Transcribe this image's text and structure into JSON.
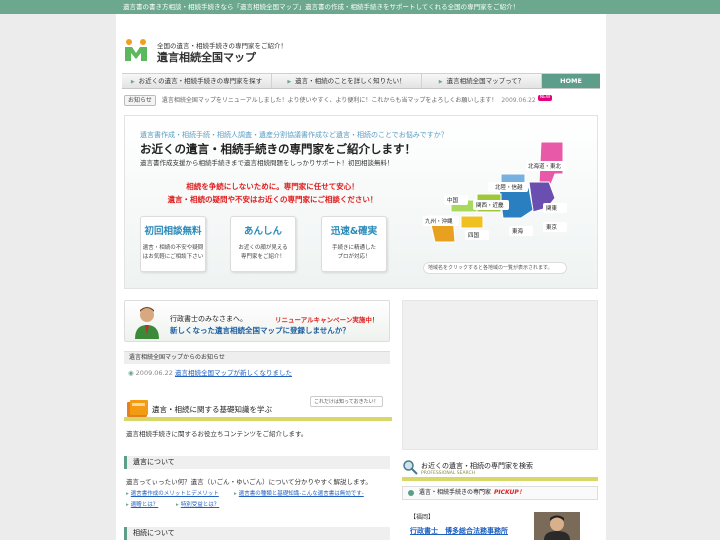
{
  "topbar": {
    "text": "遺言書の書き方相談・相続手続きなら「遺言相続全国マップ」遺言書の作成・相続手続きをサポートしてくれる全国の専門家をご紹介！"
  },
  "header": {
    "tagline": "全国の遺言・相続手続きの専門家をご紹介！",
    "site_title": "遺言相続全国マップ"
  },
  "nav": {
    "items": [
      {
        "label": "お近くの遺言・相続手続きの専門家を探す"
      },
      {
        "label": "遺言・相続のことを詳しく知りたい！"
      },
      {
        "label": "遺言相続全国マップって？"
      }
    ],
    "home_label": "HOME"
  },
  "notice": {
    "label": "お知らせ",
    "text": "遺言相続全国マップをリニューアルしました！より使いやすく、より便利に！これからも当マップをよろしくお願いします！",
    "date": "2009.06.22",
    "badge": "NEW"
  },
  "hero": {
    "subtitle": "遺言書作成・相続手続・相続人調査・遺産分割協議書作成など遺言・相続のことでお悩みですか？",
    "title": "お近くの遺言・相続手続きの専門家をご紹介します！",
    "description": "遺言書作成支援から相続手続きまで遺言相続問題をしっかりサポート！初回相談無料！",
    "message_line1": "相続を争続にしないために。専門家に任せて安心！",
    "message_line2": "遺言・相続の疑問や不安はお近くの専門家にご相談ください！",
    "features": [
      {
        "title": "初回相談無料",
        "line1": "遺言・相続の不安や疑問",
        "line2": "はお気軽にご相談下さい"
      },
      {
        "title": "あんしん",
        "line1": "お近くの顔が見える",
        "line2": "専門家をご紹介！"
      },
      {
        "title": "迅速&確実",
        "line1": "手続きに精通した",
        "line2": "プロが対応！"
      }
    ],
    "map": {
      "regions": [
        "北海道・東北",
        "北陸・信越",
        "中国",
        "関西・近畿",
        "関東",
        "九州・沖縄",
        "四国",
        "東海",
        "東京"
      ],
      "note": "地域名をクリックすると各地域の一覧が表示されます。"
    }
  },
  "admin_banner": {
    "greeting": "行政書士のみなさまへ。",
    "campaign": "リニューアルキャンペーン実施中！",
    "cta": "新しくなった遺言相続全国マップに登録しませんか？"
  },
  "news": {
    "header": "遺言相続全国マップからのお知らせ",
    "items": [
      {
        "date": "2009.06.22",
        "link": "遺言相続全国マップが新しくなりました"
      }
    ]
  },
  "basics": {
    "tag": "これだけは知っておきたい！",
    "title": "遺言・相続に関する基礎知識を学ぶ",
    "description": "遺言相続手続きに関するお役立ちコンテンツをご紹介します。"
  },
  "will_section": {
    "header": "遺言について",
    "description": "遺言ってぃったい何？遺言（いごん・ゆいごん）について分かりやすく解説します。",
    "links": [
      "遺言書作成のメリットとデメリット",
      "遺言書の種類と基礎知識-こんな遺言書は無効です-",
      "遺贈とは？",
      "特別受益とは？"
    ]
  },
  "inheritance_section": {
    "header": "相続について"
  },
  "search": {
    "title": "お近くの遺言・相続の専門家を検索",
    "subtitle": "PROFESSIONAL SEARCH",
    "pickup_label": "遺言・相続手続きの専門家",
    "pickup_word": "PICKUP！",
    "region": "【福岡】",
    "office": "行政書士　博多総合法務事務所"
  },
  "colors": {
    "accent": "#6ba88e",
    "home_bg": "#5c9e8a",
    "link": "#2060c0",
    "alert": "#e02020",
    "map_pink": "#e85aa8"
  }
}
